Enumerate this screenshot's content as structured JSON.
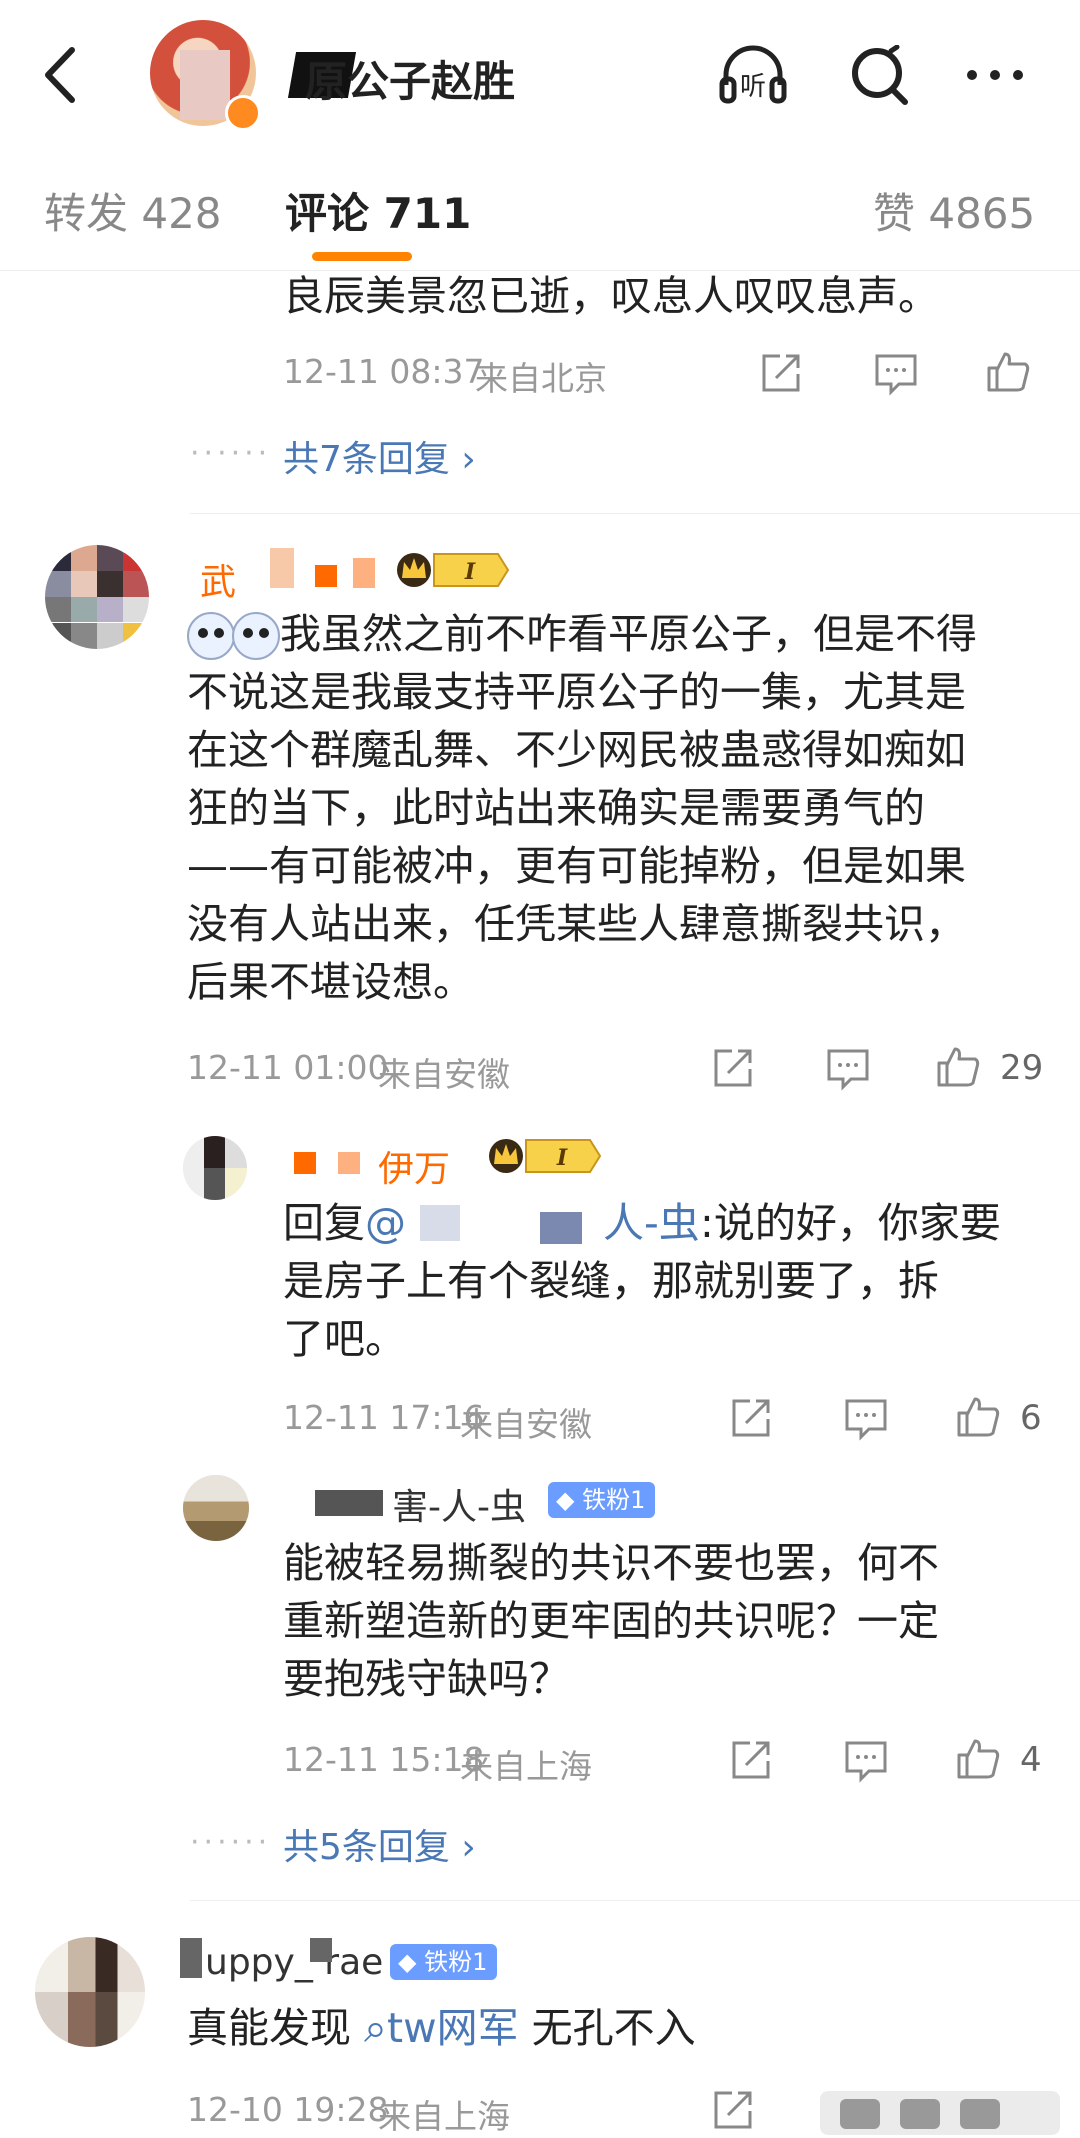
{
  "header": {
    "title": "原公子赵胜",
    "listen_label": "听"
  },
  "tabs": {
    "repost": "转发 428",
    "comment": "评论 711",
    "like": "赞 4865"
  },
  "comments": {
    "c0": {
      "text_lines": [
        "良辰美景忽已逝，叹息人叹叹息声。"
      ],
      "time": "12-11 08:37",
      "location": "来自北京",
      "replies_link": "共7条回复 ›"
    },
    "c1": {
      "username": "武",
      "username_tail": "",
      "text_lines": [
        "我虽然之前不咋看平原公子，但是不得",
        "不说这是我最支持平原公子的一集，尤其是",
        "在这个群魔乱舞、不少网民被蛊惑得如痴如",
        "狂的当下，此时站出来确实是需要勇气的",
        "——有可能被冲，更有可能掉粉，但是如果",
        "没有人站出来，任凭某些人肆意撕裂共识，",
        "后果不堪设想。"
      ],
      "time": "12-11 01:00",
      "location": "来自安徽",
      "likes": "29",
      "vip_label": "I",
      "reply1": {
        "username": "伊万",
        "vip_label": "I",
        "prefix": "回复",
        "mention": "@",
        "mention_tail": "人-虫",
        "line1": ":说的好，你家要",
        "line2": "是房子上有个裂缝，那就别要了，拆",
        "line3": "了吧。",
        "time": "12-11 17:16",
        "location": "来自安徽",
        "likes": "6"
      },
      "reply2": {
        "username": "害-人-虫",
        "fan_badge": "铁粉1",
        "text_lines": [
          "能被轻易撕裂的共识不要也罢，何不",
          "重新塑造新的更牢固的共识呢？一定",
          "要抱残守缺吗？"
        ],
        "time": "12-11 15:18",
        "location": "来自上海",
        "likes": "4"
      },
      "replies_link": "共5条回复 ›"
    },
    "c2": {
      "username": "uppy_ rae",
      "fan_badge": "铁粉1",
      "text_before": "真能发现 ",
      "link_text": "tw网军",
      "text_after": " 无孔不入",
      "time": "12-10 19:28",
      "location": "来自上海"
    }
  },
  "colors": {
    "accent": "#ff8200",
    "link": "#4a78b5",
    "username": "#ff6a00",
    "fan_badge": "#6b9cff"
  }
}
